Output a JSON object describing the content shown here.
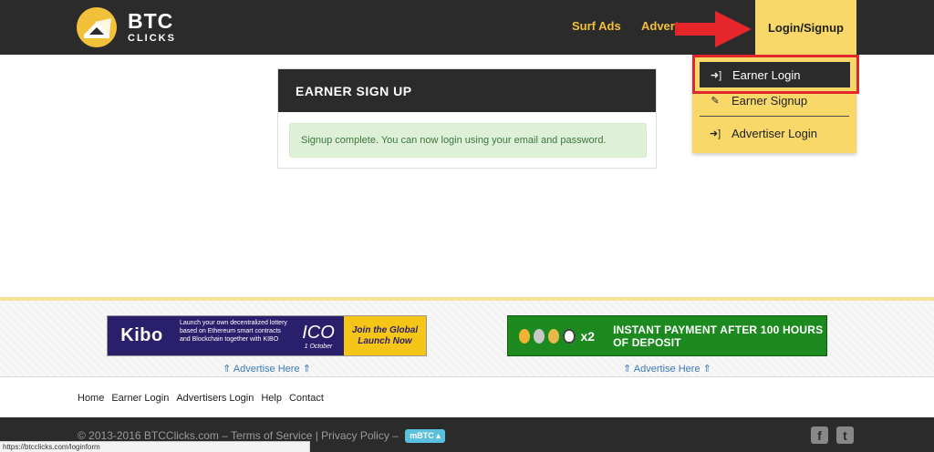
{
  "brand": {
    "name": "BTC",
    "sub": "CLICKS",
    "color": "#f2c13a"
  },
  "nav": {
    "surf_ads": "Surf Ads",
    "advertise": "Advertise",
    "login_signup": "Login/Signup"
  },
  "dropdown": {
    "items": [
      {
        "label": "Earner Login",
        "icon": "sign-in-icon"
      },
      {
        "label": "Earner Signup",
        "icon": "edit-icon"
      },
      {
        "label": "Advertiser Login",
        "icon": "sign-in-icon"
      }
    ]
  },
  "panel": {
    "title": "EARNER SIGN UP",
    "message": "Signup complete. You can now login using your email and password."
  },
  "ads": {
    "kibo": {
      "brand": "Kibo",
      "text": "Launch your own decentralized lottery based on Ethereum smart contracts and Blockchain together with KIBO",
      "ico": "ICO",
      "ico_date": "1 October",
      "cta": "Join the Global Launch Now"
    },
    "coins": {
      "multiplier": "x2",
      "text": "INSTANT PAYMENT AFTER 100 HOURS OF DEPOSIT"
    },
    "advertise_here": "⇑ Advertise Here ⇑"
  },
  "footer": {
    "links": [
      "Home",
      "Earner Login",
      "Advertisers Login",
      "Help",
      "Contact"
    ],
    "copyright": "© 2013-2016 BTCClicks.com – Terms of Service | Privacy Policy –",
    "currency_badge": "mBTC ▴"
  },
  "status_url": "https://btcclicks.com/loginform",
  "colors": {
    "accent": "#f9d86a",
    "dark": "#2b2b2b",
    "annotation": "#e4262b"
  }
}
